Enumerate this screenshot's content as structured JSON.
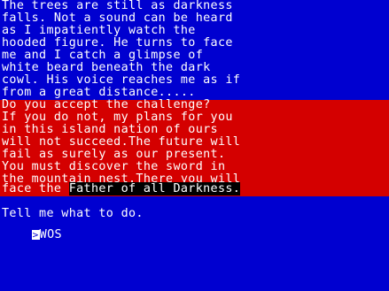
{
  "narration": [
    "The trees are still as darkness",
    "falls. Not a sound can be heard",
    "as I impatiently watch the",
    "hooded figure. He turns to face",
    "me and I catch a glimpse of",
    "white beard beneath the dark",
    "cowl. His voice reaches me as if",
    "from a great distance....."
  ],
  "speech": [
    "Do you accept the challenge?",
    "If you do not, my plans for you",
    "in this island nation of ours",
    "will not succeed.The future will",
    "fail as surely as our present.",
    "You must discover the sword in",
    "the mountain nest.There you will"
  ],
  "speech_last": {
    "prefix": "face the ",
    "highlight": "Father of all Darkness."
  },
  "prompt": "Tell me what to do.",
  "input": {
    "cursor_glyph": ">",
    "value": "WOS"
  },
  "colors": {
    "background": "#0000d0",
    "speech_band": "#d40000",
    "text": "#ffffff",
    "highlight_bg": "#000000"
  }
}
